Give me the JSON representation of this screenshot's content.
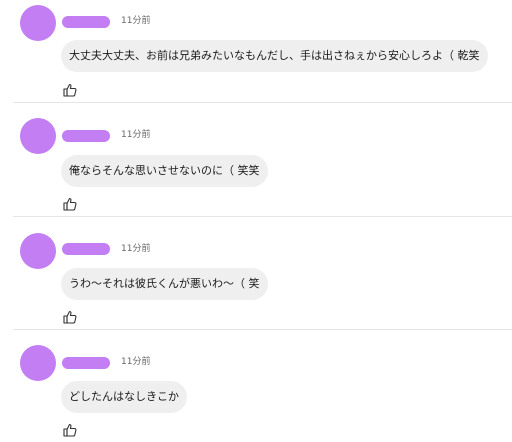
{
  "colors": {
    "avatar_redaction": "#c27ef2",
    "bubble_background": "#efefef",
    "divider": "#e6e6e6"
  },
  "comments": [
    {
      "timestamp": "11分前",
      "text": "大丈夫大丈夫、お前は兄弟みたいなもんだし、手は出さねぇから安心しろよ（ 乾笑",
      "like_icon": "thumbs-up-icon"
    },
    {
      "timestamp": "11分前",
      "text": "俺ならそんな思いさせないのに（ 笑笑",
      "like_icon": "thumbs-up-icon"
    },
    {
      "timestamp": "11分前",
      "text": "うわ〜それは彼氏くんが悪いわ〜（ 笑",
      "like_icon": "thumbs-up-icon"
    },
    {
      "timestamp": "11分前",
      "text": "どしたんはなしきこか",
      "like_icon": "thumbs-up-icon"
    }
  ]
}
